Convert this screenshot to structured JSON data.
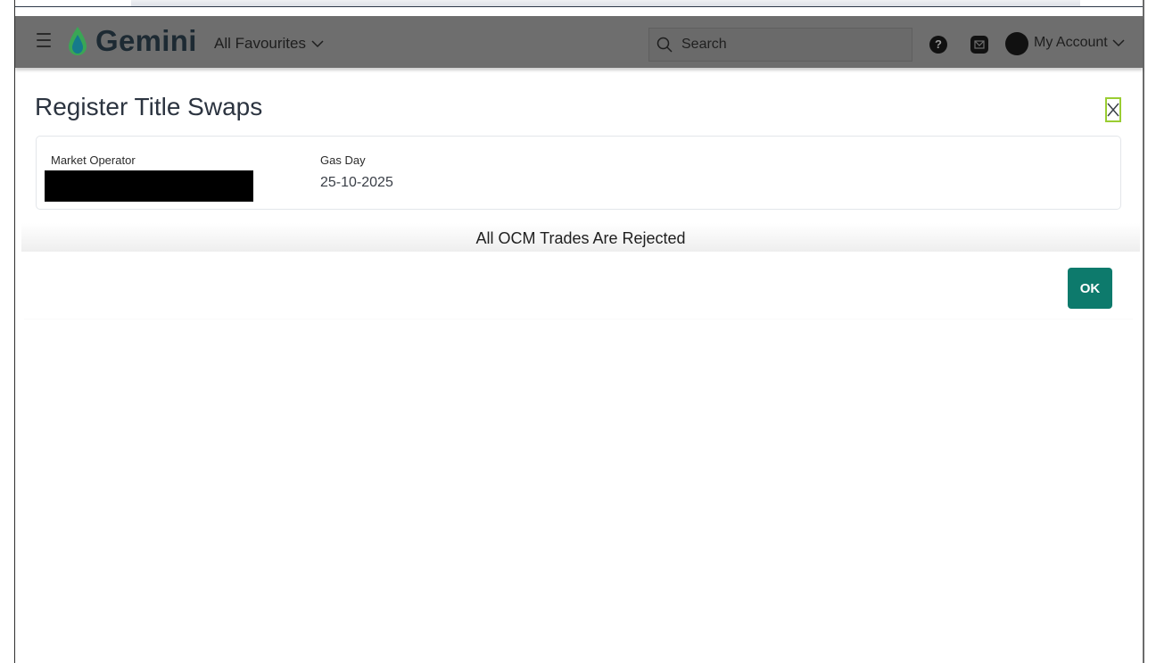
{
  "nav": {
    "brand": "Gemini",
    "favourites_label": "All Favourites",
    "search_placeholder": "Search",
    "help_symbol": "?",
    "account_label": "My Account",
    "icons": [
      "hamburger-menu-icon",
      "gemini-logo-drop-icon",
      "chevron-down-icon",
      "search-icon",
      "help-icon",
      "mail-icon",
      "avatar",
      "chevron-down-icon"
    ]
  },
  "page": {
    "title": "Register Title Swaps",
    "close_icon": "close-icon"
  },
  "info": {
    "market_operator_label": "Market Operator",
    "market_operator_value": "",
    "gas_day_label": "Gas Day",
    "gas_day_value": "25-10-2025"
  },
  "dialog": {
    "message": "All OCM Trades Are Rejected",
    "ok_label": "OK"
  },
  "colors": {
    "navbar": "#6e6e6e",
    "ok_button": "#0d7a6c",
    "close_border": "#9acd32",
    "logo_green": "#3aa655",
    "logo_teal": "#157a8c"
  }
}
